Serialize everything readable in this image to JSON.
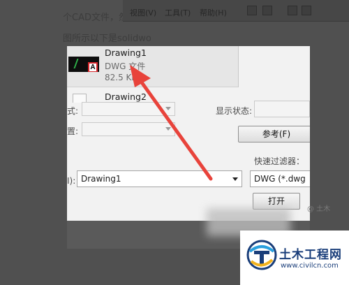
{
  "background": {
    "article_line1": "个CAD文件，然后打",
    "article_line2": "图所示以下是solidwo",
    "menubar": {
      "items": [
        "视图(V)",
        "工具(T)",
        "帮助(H)"
      ]
    }
  },
  "dialog": {
    "file_card": {
      "name": "Drawing1",
      "type": "DWG 文件",
      "size": "82.5 KB",
      "thumb_badge": "A"
    },
    "second_file": {
      "name": "Drawing2"
    },
    "fields": {
      "style_label": "式:",
      "position_label": "置:",
      "display_state_label": "显示状态:",
      "reference_button": "参考(F)",
      "quick_filter_label": "快速过滤器：",
      "filename_label": "I):",
      "filename_value": "Drawing1",
      "filetype_value": "DWG (*.dwg",
      "open_button": "打开"
    }
  },
  "watermark": {
    "title": "土木工程网",
    "url": "www.civilcn.com",
    "small": "@ 土木"
  },
  "colors": {
    "arrow": "#e8433b",
    "watermark_blue": "#1a3e7a",
    "badge_red": "#d8262b"
  }
}
